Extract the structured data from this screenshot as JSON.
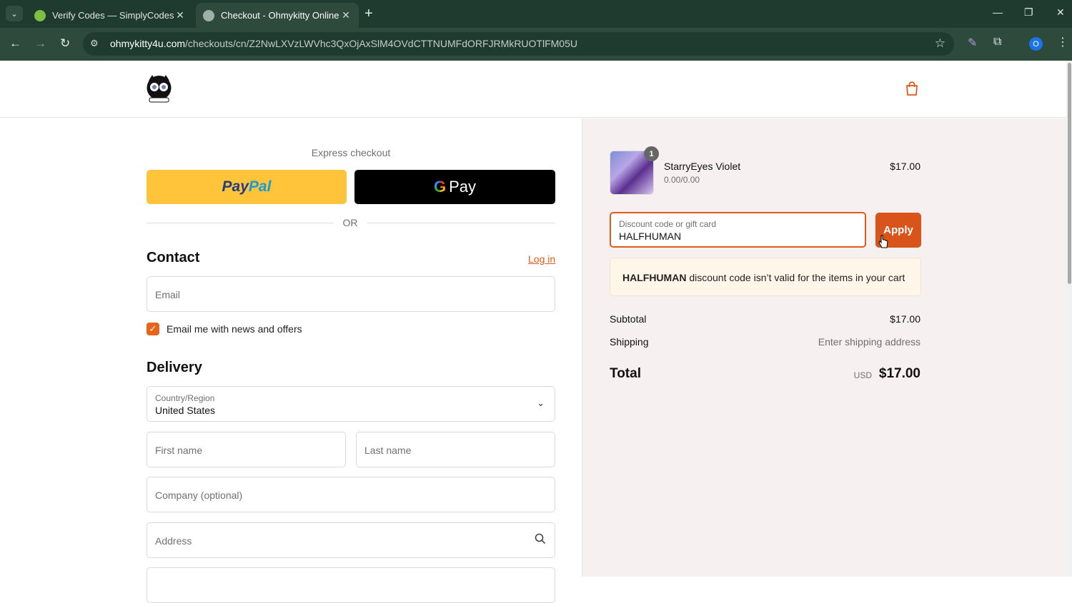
{
  "browser": {
    "tabs": [
      {
        "title": "Verify Codes — SimplyCodes",
        "active": false
      },
      {
        "title": "Checkout - Ohmykitty Online St",
        "active": true
      }
    ],
    "url_host": "ohmykitty4u.com",
    "url_path": "/checkouts/cn/Z2NwLXVzLWVhc3QxOjAxSlM4OVdCTTNUMFdORFJRMkRUOTlFM05U",
    "profile_initial": "O"
  },
  "header": {
    "logo_text": "ohmykitty"
  },
  "checkout": {
    "express_label": "Express checkout",
    "paypal_part1": "Pay",
    "paypal_part2": "Pal",
    "gpay_g": "G",
    "gpay_label": "Pay",
    "or_text": "OR",
    "contact_heading": "Contact",
    "login_link": "Log in",
    "email_placeholder": "Email",
    "newsletter_label": "Email me with news and offers",
    "newsletter_checked": true,
    "delivery_heading": "Delivery",
    "country_label": "Country/Region",
    "country_value": "United States",
    "first_name_placeholder": "First name",
    "last_name_placeholder": "Last name",
    "company_placeholder": "Company (optional)",
    "address_placeholder": "Address"
  },
  "summary": {
    "product": {
      "name": "StarryEyes Violet",
      "variant": "0.00/0.00",
      "price": "$17.00",
      "quantity": "1"
    },
    "discount_label": "Discount code or gift card",
    "discount_value": "HALFHUMAN",
    "apply_label": "Apply",
    "error_code": "HALFHUMAN",
    "error_message": " discount code isn’t valid for the items in your cart",
    "subtotal_label": "Subtotal",
    "subtotal_value": "$17.00",
    "shipping_label": "Shipping",
    "shipping_value": "Enter shipping address",
    "total_label": "Total",
    "total_currency": "USD",
    "total_value": "$17.00"
  },
  "colors": {
    "accent": "#e05a1b",
    "browser_frame": "#1f3b2f",
    "paypal_yellow": "#ffc439"
  }
}
